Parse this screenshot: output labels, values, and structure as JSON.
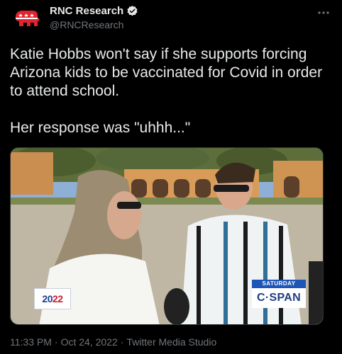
{
  "author": {
    "display_name": "RNC Research",
    "handle": "@RNCResearch",
    "avatar_icon": "republican-elephant-icon",
    "verified_icon": "verified-badge-icon"
  },
  "tweet": {
    "text": "Katie Hobbs won't say if she supports forcing Arizona kids to be vaccinated for Covid in order to attend school.\n\nHer response was \"uhhh...\""
  },
  "media": {
    "bug_2022_line1": "20",
    "bug_2022_line2": "22",
    "cspan_day": "SATURDAY",
    "cspan_logo": "C·SPAN"
  },
  "footer": {
    "time": "11:33 PM",
    "separator": "·",
    "date": "Oct 24, 2022",
    "source": "Twitter Media Studio"
  },
  "colors": {
    "background": "#000000",
    "text": "#e7e9ea",
    "secondary": "#71767b",
    "brand_red": "#e0242e",
    "verified": "#ffffff"
  }
}
